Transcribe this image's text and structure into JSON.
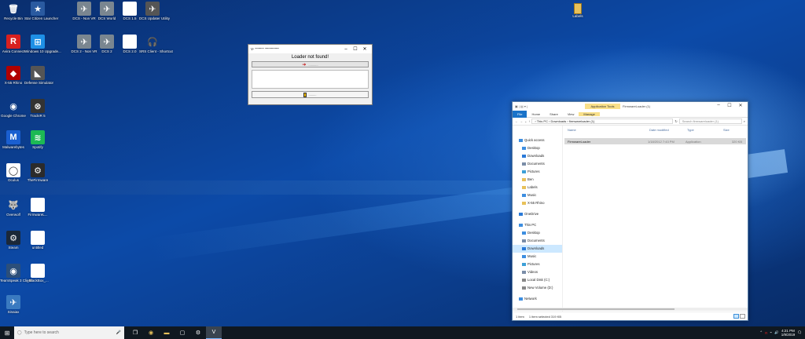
{
  "desktop": {
    "icons": [
      {
        "label": "Recycle Bin",
        "glyph": "🗑",
        "bg": "transparent"
      },
      {
        "label": "Star Citizen Launcher",
        "glyph": "★",
        "bg": "#2a5aa0"
      },
      {
        "label": "DCS - Non VR",
        "glyph": "✈",
        "bg": "#7a8690"
      },
      {
        "label": "DCS World",
        "glyph": "✈",
        "bg": "#7a8690"
      },
      {
        "label": "DCS 1.5",
        "glyph": "",
        "bg": "#ffffff"
      },
      {
        "label": "DCS Updater Utility",
        "glyph": "✈",
        "bg": "#555"
      },
      {
        "label": "Avira Connect",
        "glyph": "R",
        "bg": "#d8201f"
      },
      {
        "label": "Windows 10 Upgrade...",
        "glyph": "⊞",
        "bg": "#1e90e6"
      },
      {
        "label": "DCS 2 - Non VR",
        "glyph": "✈",
        "bg": "#7a8690"
      },
      {
        "label": "DCS 2",
        "glyph": "✈",
        "bg": "#7a8690"
      },
      {
        "label": "DCS 2.0",
        "glyph": "",
        "bg": "#ffffff"
      },
      {
        "label": "SRS Client - Shortcut",
        "glyph": "🎧",
        "bg": "transparent"
      },
      {
        "label": "X-55 Rhino",
        "glyph": "◆",
        "bg": "#b00000"
      },
      {
        "label": "Defense Simulator",
        "glyph": "◣",
        "bg": "#555"
      },
      {
        "label": "Google Chrome",
        "glyph": "◉",
        "bg": "transparent"
      },
      {
        "label": "TrackIR 5",
        "glyph": "⊗",
        "bg": "#333"
      },
      {
        "label": "Malwarebytes",
        "glyph": "M",
        "bg": "#1a5fd0"
      },
      {
        "label": "Spotify",
        "glyph": "≋",
        "bg": "#1db954"
      },
      {
        "label": "Oculus",
        "glyph": "◯",
        "bg": "#ffffff"
      },
      {
        "label": "TheFirmware",
        "glyph": "⚙",
        "bg": "#2b2b2b"
      },
      {
        "label": "Overwolf",
        "glyph": "🐺",
        "bg": "transparent"
      },
      {
        "label": "FirmwareL...",
        "glyph": "",
        "bg": "#ffffff"
      },
      {
        "label": "Steam",
        "glyph": "⚙",
        "bg": "#1b2838"
      },
      {
        "label": "untitled",
        "glyph": "",
        "bg": "#ffffff"
      },
      {
        "label": "TeamSpeak 3 Client",
        "glyph": "◉",
        "bg": "#2c4f7a"
      },
      {
        "label": "_BlackBox_...",
        "glyph": "",
        "bg": "#ffffff"
      },
      {
        "label": "Sinaiax",
        "glyph": "✈",
        "bg": "#3a7ac0"
      }
    ],
    "label_icon": "Labels"
  },
  "dialog": {
    "title": "V- ''''''''''''' '''''''''''''''''''''",
    "heading": "Loader not found!",
    "bar_text": "...........",
    "footer_text": ".........",
    "min": "–",
    "max": "☐",
    "close": "✕"
  },
  "explorer": {
    "app_tools": "Application Tools",
    "window_title": "FirmwareLoader (1)",
    "ribbon": {
      "file": "File",
      "home": "Home",
      "share": "Share",
      "view": "View",
      "manage": "Manage"
    },
    "address": "› This PC › Downloads › firmwareloader (1)",
    "search_placeholder": "Search firmwareloader (1)",
    "columns": {
      "name": "Name",
      "date": "Date modified",
      "type": "Type",
      "size": "Size"
    },
    "file": {
      "name": "FirmwareLoader",
      "date": "1/18/2012 7:43 PM",
      "type": "Application",
      "size": "320 KB"
    },
    "nav": [
      {
        "label": "Quick access",
        "level": 1,
        "color": "#3d8ee0"
      },
      {
        "label": "Desktop",
        "level": 2,
        "color": "#3d8ee0"
      },
      {
        "label": "Downloads",
        "level": 2,
        "color": "#2a7ad8"
      },
      {
        "label": "Documents",
        "level": 2,
        "color": "#7a8da8"
      },
      {
        "label": "Pictures",
        "level": 2,
        "color": "#3da0d8"
      },
      {
        "label": "Ben",
        "level": 2,
        "color": "#e8c15a"
      },
      {
        "label": "Labels",
        "level": 2,
        "color": "#e8c15a"
      },
      {
        "label": "Music",
        "level": 2,
        "color": "#3d8ee0"
      },
      {
        "label": "X-55 Rhino",
        "level": 2,
        "color": "#e8c15a"
      },
      {
        "label": "OneDrive",
        "level": 1,
        "color": "#2a7ad8"
      },
      {
        "label": "This PC",
        "level": 1,
        "color": "#3d8ee0"
      },
      {
        "label": "Desktop",
        "level": 2,
        "color": "#3d8ee0"
      },
      {
        "label": "Documents",
        "level": 2,
        "color": "#7a8da8"
      },
      {
        "label": "Downloads",
        "level": 2,
        "color": "#2a7ad8"
      },
      {
        "label": "Music",
        "level": 2,
        "color": "#3d8ee0"
      },
      {
        "label": "Pictures",
        "level": 2,
        "color": "#3da0d8"
      },
      {
        "label": "Videos",
        "level": 2,
        "color": "#7a8da8"
      },
      {
        "label": "Local Disk (C:)",
        "level": 2,
        "color": "#888"
      },
      {
        "label": "New Volume (D:)",
        "level": 2,
        "color": "#888"
      },
      {
        "label": "Network",
        "level": 1,
        "color": "#3d8ee0"
      }
    ],
    "status_items": "1 item",
    "status_selected": "1 item selected 319 KB"
  },
  "taskbar": {
    "search_placeholder": "Type here to search",
    "time": "4:21 PM",
    "date": "1/9/2019"
  }
}
